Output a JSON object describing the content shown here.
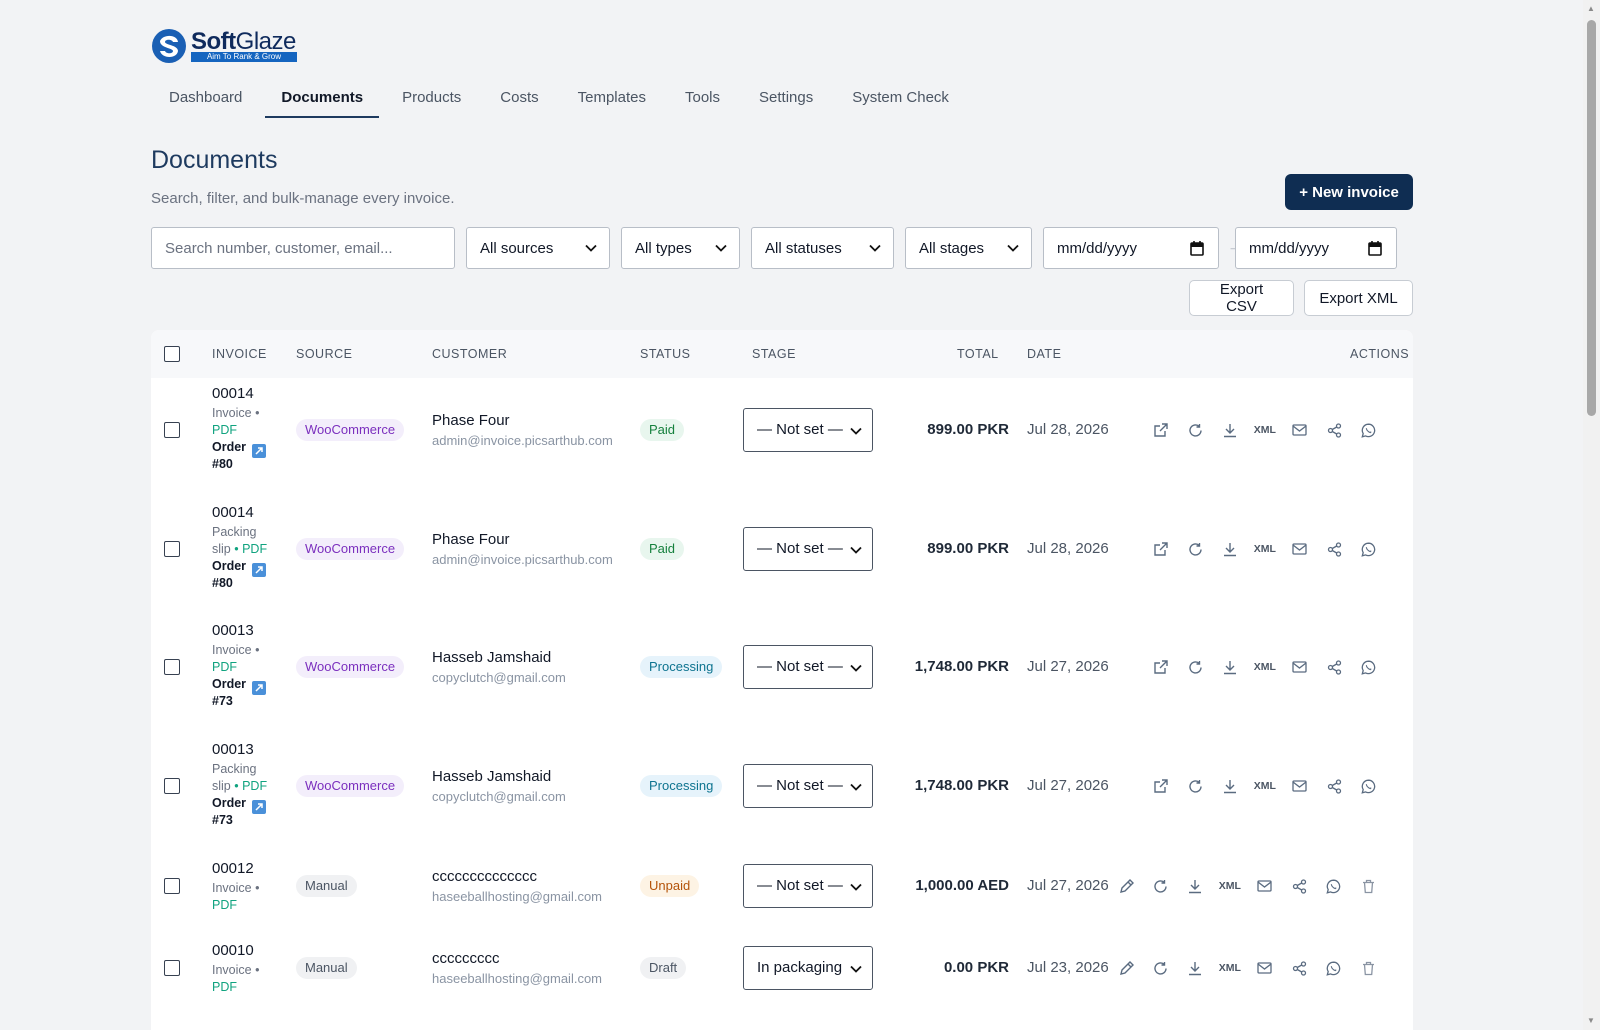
{
  "brand": {
    "name_bold": "Soft",
    "name_light": "Glaze",
    "tagline": "Aim To Rank & Grow"
  },
  "nav": [
    "Dashboard",
    "Documents",
    "Products",
    "Costs",
    "Templates",
    "Tools",
    "Settings",
    "System Check"
  ],
  "header": {
    "title": "Documents",
    "subtitle": "Search, filter, and bulk-manage every invoice.",
    "new_button": "+ New invoice"
  },
  "filters": {
    "search_placeholder": "Search number, customer, email...",
    "source": "All sources",
    "type": "All types",
    "status": "All statuses",
    "stage": "All stages",
    "date_from": "mm/dd/yyyy",
    "date_sep": "→",
    "date_to": "mm/dd/yyyy"
  },
  "exports": {
    "csv": "Export CSV",
    "xml": "Export XML"
  },
  "table": {
    "columns": {
      "invoice": "INVOICE",
      "source": "SOURCE",
      "customer": "CUSTOMER",
      "status": "STATUS",
      "stage": "STAGE",
      "total": "TOTAL",
      "date": "DATE",
      "actions": "ACTIONS"
    },
    "xml_label": "XML",
    "rows": [
      {
        "number": "00014",
        "meta1": "Invoice •",
        "meta2": "PDF",
        "order1": "Order",
        "order2": "#80",
        "source": "WooCommerce",
        "customer": "Phase Four",
        "email": "admin@invoice.picsarthub.com",
        "status": "Paid",
        "stage": "— Not set —",
        "total": "899.00 PKR",
        "date": "Jul 28, 2026"
      },
      {
        "number": "00014",
        "meta1": "Packing",
        "meta2": "slip",
        "meta2pdf": "• PDF",
        "order1": "Order",
        "order2": "#80",
        "source": "WooCommerce",
        "customer": "Phase Four",
        "email": "admin@invoice.picsarthub.com",
        "status": "Paid",
        "stage": "— Not set —",
        "total": "899.00 PKR",
        "date": "Jul 28, 2026"
      },
      {
        "number": "00013",
        "meta1": "Invoice •",
        "meta2": "PDF",
        "order1": "Order",
        "order2": "#73",
        "source": "WooCommerce",
        "customer": "Hasseb Jamshaid",
        "email": "copyclutch@gmail.com",
        "status": "Processing",
        "stage": "— Not set —",
        "total": "1,748.00 PKR",
        "date": "Jul 27, 2026"
      },
      {
        "number": "00013",
        "meta1": "Packing",
        "meta2": "slip",
        "meta2pdf": "• PDF",
        "order1": "Order",
        "order2": "#73",
        "source": "WooCommerce",
        "customer": "Hasseb Jamshaid",
        "email": "copyclutch@gmail.com",
        "status": "Processing",
        "stage": "— Not set —",
        "total": "1,748.00 PKR",
        "date": "Jul 27, 2026"
      },
      {
        "number": "00012",
        "meta1": "Invoice •",
        "meta2": "PDF",
        "source": "Manual",
        "customer": "cccccccccccccc",
        "email": "haseeballhosting@gmail.com",
        "status": "Unpaid",
        "stage": "— Not set —",
        "total": "1,000.00 AED",
        "date": "Jul 27, 2026"
      },
      {
        "number": "00010",
        "meta1": "Invoice •",
        "meta2": "PDF",
        "source": "Manual",
        "customer": "ccccccccc",
        "email": "haseeballhosting@gmail.com",
        "status": "Draft",
        "stage": "In packaging",
        "total": "0.00 PKR",
        "date": "Jul 23, 2026"
      }
    ]
  },
  "icons": [
    "external-link-icon",
    "refresh-icon",
    "edit-icon",
    "download-icon",
    "mail-icon",
    "share-icon",
    "whatsapp-icon",
    "trash-icon",
    "chevron-down-icon",
    "calendar-icon",
    "order-link-icon"
  ],
  "colors": {
    "primary": "#0f2d52",
    "accent_tab": "#1e3a5f",
    "pdf_green": "#10a37f"
  }
}
